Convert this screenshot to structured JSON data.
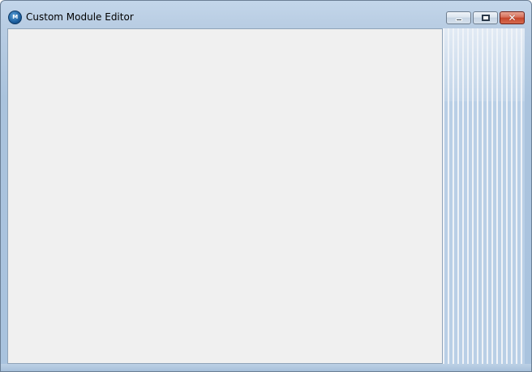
{
  "window": {
    "title": "Custom Module Editor",
    "app_icon": {
      "name": "module-editor-app-icon",
      "text": "M"
    },
    "controls": {
      "minimize": "minimize-icon",
      "maximize": "maximize-icon",
      "close": "close-icon"
    }
  },
  "colors": {
    "frame": "#aac3dd",
    "client_background": "#f0f0f0",
    "close_button": "#c5452b"
  }
}
